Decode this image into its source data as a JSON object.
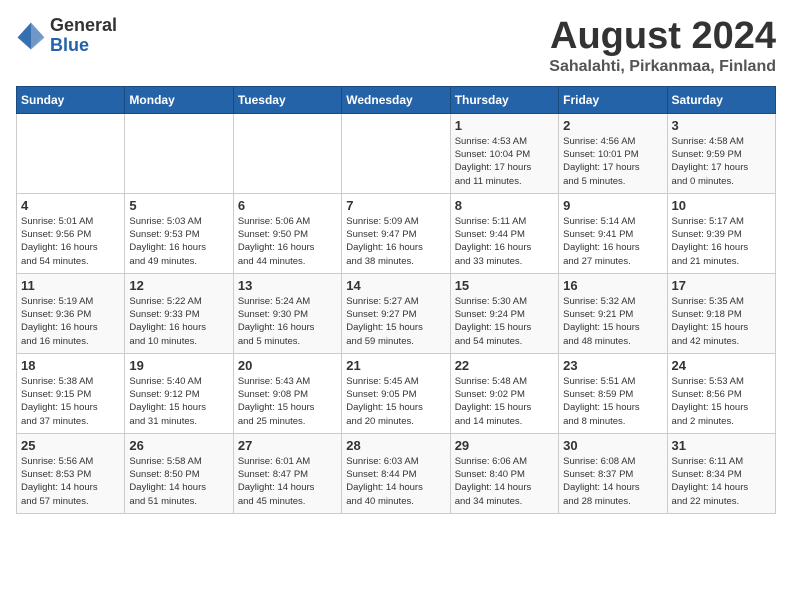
{
  "header": {
    "logo_general": "General",
    "logo_blue": "Blue",
    "month_title": "August 2024",
    "location": "Sahalahti, Pirkanmaa, Finland"
  },
  "days_of_week": [
    "Sunday",
    "Monday",
    "Tuesday",
    "Wednesday",
    "Thursday",
    "Friday",
    "Saturday"
  ],
  "weeks": [
    [
      {
        "day": "",
        "info": ""
      },
      {
        "day": "",
        "info": ""
      },
      {
        "day": "",
        "info": ""
      },
      {
        "day": "",
        "info": ""
      },
      {
        "day": "1",
        "info": "Sunrise: 4:53 AM\nSunset: 10:04 PM\nDaylight: 17 hours\nand 11 minutes."
      },
      {
        "day": "2",
        "info": "Sunrise: 4:56 AM\nSunset: 10:01 PM\nDaylight: 17 hours\nand 5 minutes."
      },
      {
        "day": "3",
        "info": "Sunrise: 4:58 AM\nSunset: 9:59 PM\nDaylight: 17 hours\nand 0 minutes."
      }
    ],
    [
      {
        "day": "4",
        "info": "Sunrise: 5:01 AM\nSunset: 9:56 PM\nDaylight: 16 hours\nand 54 minutes."
      },
      {
        "day": "5",
        "info": "Sunrise: 5:03 AM\nSunset: 9:53 PM\nDaylight: 16 hours\nand 49 minutes."
      },
      {
        "day": "6",
        "info": "Sunrise: 5:06 AM\nSunset: 9:50 PM\nDaylight: 16 hours\nand 44 minutes."
      },
      {
        "day": "7",
        "info": "Sunrise: 5:09 AM\nSunset: 9:47 PM\nDaylight: 16 hours\nand 38 minutes."
      },
      {
        "day": "8",
        "info": "Sunrise: 5:11 AM\nSunset: 9:44 PM\nDaylight: 16 hours\nand 33 minutes."
      },
      {
        "day": "9",
        "info": "Sunrise: 5:14 AM\nSunset: 9:41 PM\nDaylight: 16 hours\nand 27 minutes."
      },
      {
        "day": "10",
        "info": "Sunrise: 5:17 AM\nSunset: 9:39 PM\nDaylight: 16 hours\nand 21 minutes."
      }
    ],
    [
      {
        "day": "11",
        "info": "Sunrise: 5:19 AM\nSunset: 9:36 PM\nDaylight: 16 hours\nand 16 minutes."
      },
      {
        "day": "12",
        "info": "Sunrise: 5:22 AM\nSunset: 9:33 PM\nDaylight: 16 hours\nand 10 minutes."
      },
      {
        "day": "13",
        "info": "Sunrise: 5:24 AM\nSunset: 9:30 PM\nDaylight: 16 hours\nand 5 minutes."
      },
      {
        "day": "14",
        "info": "Sunrise: 5:27 AM\nSunset: 9:27 PM\nDaylight: 15 hours\nand 59 minutes."
      },
      {
        "day": "15",
        "info": "Sunrise: 5:30 AM\nSunset: 9:24 PM\nDaylight: 15 hours\nand 54 minutes."
      },
      {
        "day": "16",
        "info": "Sunrise: 5:32 AM\nSunset: 9:21 PM\nDaylight: 15 hours\nand 48 minutes."
      },
      {
        "day": "17",
        "info": "Sunrise: 5:35 AM\nSunset: 9:18 PM\nDaylight: 15 hours\nand 42 minutes."
      }
    ],
    [
      {
        "day": "18",
        "info": "Sunrise: 5:38 AM\nSunset: 9:15 PM\nDaylight: 15 hours\nand 37 minutes."
      },
      {
        "day": "19",
        "info": "Sunrise: 5:40 AM\nSunset: 9:12 PM\nDaylight: 15 hours\nand 31 minutes."
      },
      {
        "day": "20",
        "info": "Sunrise: 5:43 AM\nSunset: 9:08 PM\nDaylight: 15 hours\nand 25 minutes."
      },
      {
        "day": "21",
        "info": "Sunrise: 5:45 AM\nSunset: 9:05 PM\nDaylight: 15 hours\nand 20 minutes."
      },
      {
        "day": "22",
        "info": "Sunrise: 5:48 AM\nSunset: 9:02 PM\nDaylight: 15 hours\nand 14 minutes."
      },
      {
        "day": "23",
        "info": "Sunrise: 5:51 AM\nSunset: 8:59 PM\nDaylight: 15 hours\nand 8 minutes."
      },
      {
        "day": "24",
        "info": "Sunrise: 5:53 AM\nSunset: 8:56 PM\nDaylight: 15 hours\nand 2 minutes."
      }
    ],
    [
      {
        "day": "25",
        "info": "Sunrise: 5:56 AM\nSunset: 8:53 PM\nDaylight: 14 hours\nand 57 minutes."
      },
      {
        "day": "26",
        "info": "Sunrise: 5:58 AM\nSunset: 8:50 PM\nDaylight: 14 hours\nand 51 minutes."
      },
      {
        "day": "27",
        "info": "Sunrise: 6:01 AM\nSunset: 8:47 PM\nDaylight: 14 hours\nand 45 minutes."
      },
      {
        "day": "28",
        "info": "Sunrise: 6:03 AM\nSunset: 8:44 PM\nDaylight: 14 hours\nand 40 minutes."
      },
      {
        "day": "29",
        "info": "Sunrise: 6:06 AM\nSunset: 8:40 PM\nDaylight: 14 hours\nand 34 minutes."
      },
      {
        "day": "30",
        "info": "Sunrise: 6:08 AM\nSunset: 8:37 PM\nDaylight: 14 hours\nand 28 minutes."
      },
      {
        "day": "31",
        "info": "Sunrise: 6:11 AM\nSunset: 8:34 PM\nDaylight: 14 hours\nand 22 minutes."
      }
    ]
  ]
}
